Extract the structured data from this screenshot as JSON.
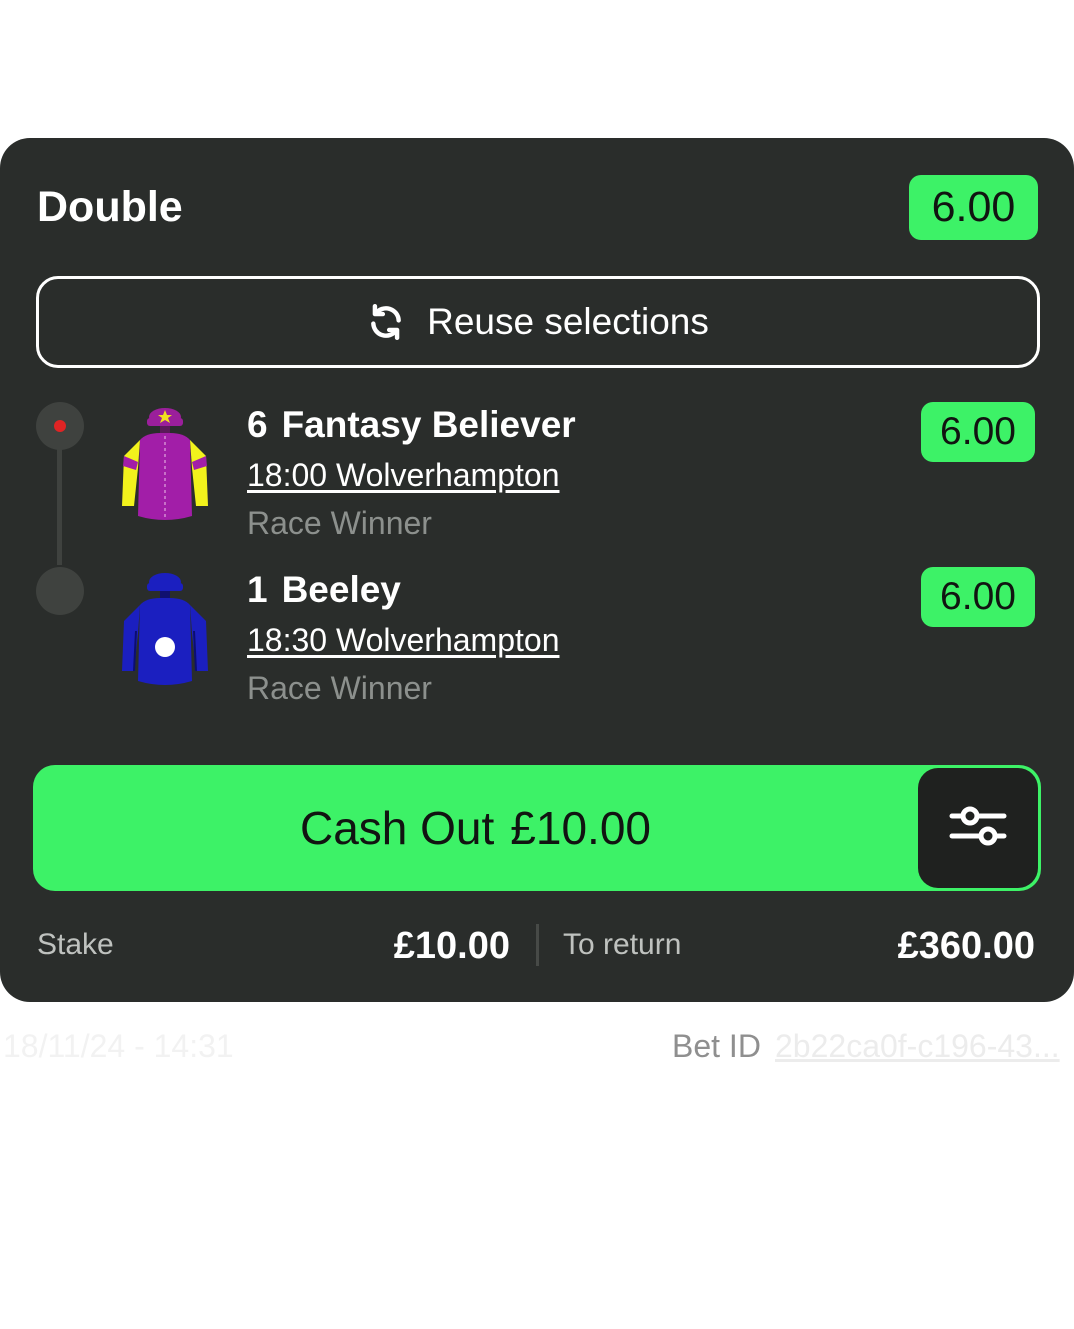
{
  "bet": {
    "type": "Double",
    "total_odds": "6.00",
    "reuse_label": "Reuse selections"
  },
  "selections": [
    {
      "number": "6",
      "name": "Fantasy Believer",
      "race": "18:00 Wolverhampton",
      "market": "Race Winner",
      "odds": "6.00",
      "silk_icon": "jockey-silk-purple-yellow-sleeves-icon",
      "status": "live"
    },
    {
      "number": "1",
      "name": "Beeley",
      "race": "18:30 Wolverhampton",
      "market": "Race Winner",
      "odds": "6.00",
      "silk_icon": "jockey-silk-blue-white-dot-icon",
      "status": "pending"
    }
  ],
  "cashout": {
    "label": "Cash Out",
    "amount": "£10.00"
  },
  "summary": {
    "stake_label": "Stake",
    "stake_value": "£10.00",
    "return_label": "To return",
    "return_value": "£360.00"
  },
  "meta": {
    "placed_date": "18/11/24 - 14:31",
    "bet_id_label": "Bet ID",
    "bet_id_value": "2b22ca0f-c196-43..."
  },
  "colors": {
    "card_bg": "#2a2d2b",
    "accent_green": "#3df267",
    "live_dot": "#e02424"
  }
}
